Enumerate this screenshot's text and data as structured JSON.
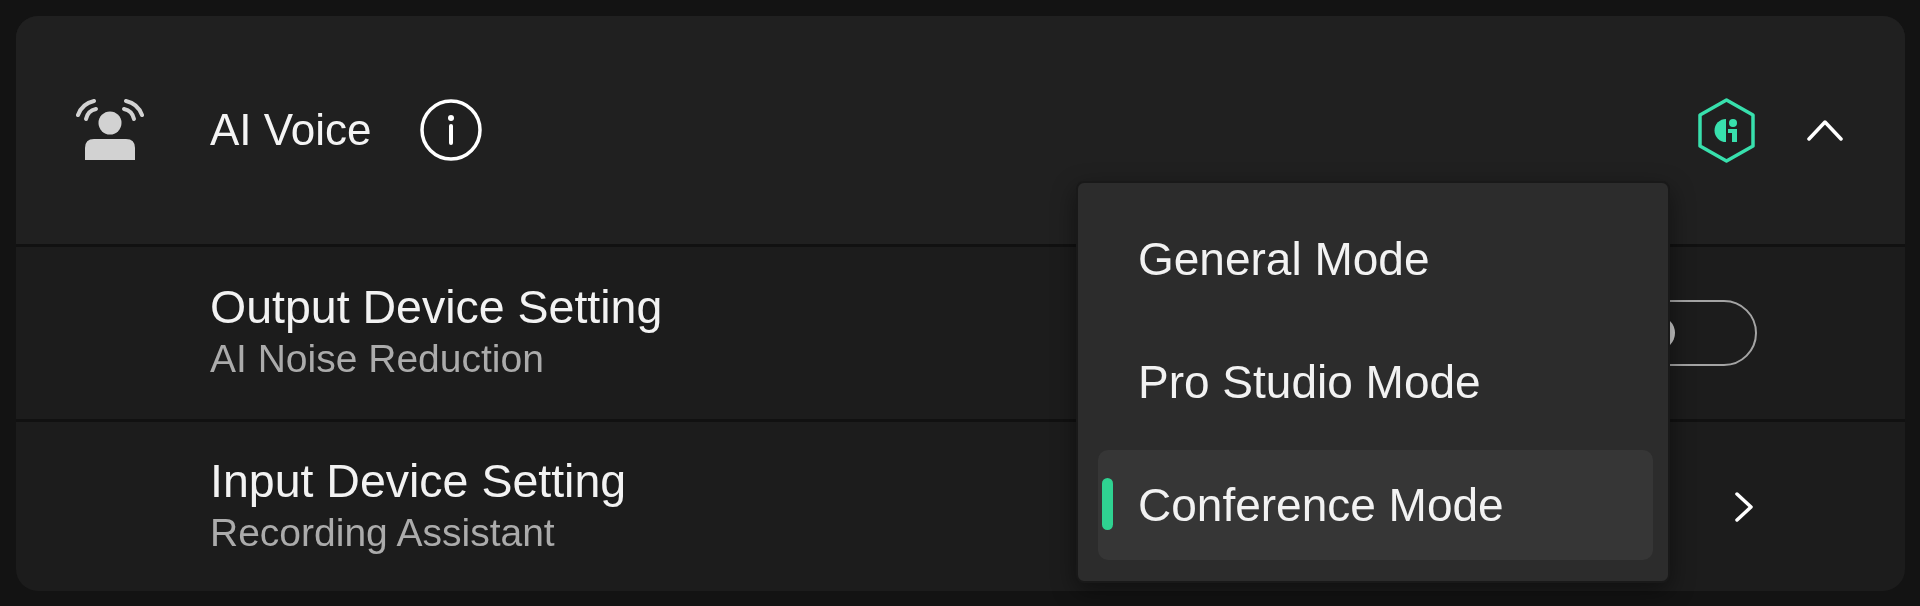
{
  "section": {
    "title": "AI Voice",
    "expanded": true
  },
  "rows": [
    {
      "kind": "toggle",
      "title": "Output Device Setting",
      "subtitle": "AI Noise Reduction",
      "on": false
    },
    {
      "kind": "link",
      "title": "Input Device Setting",
      "subtitle": "Recording Assistant"
    }
  ],
  "dropdown": {
    "items": [
      {
        "label": "General Mode",
        "selected": false
      },
      {
        "label": "Pro Studio Mode",
        "selected": false
      },
      {
        "label": "Conference Mode",
        "selected": true
      }
    ]
  }
}
